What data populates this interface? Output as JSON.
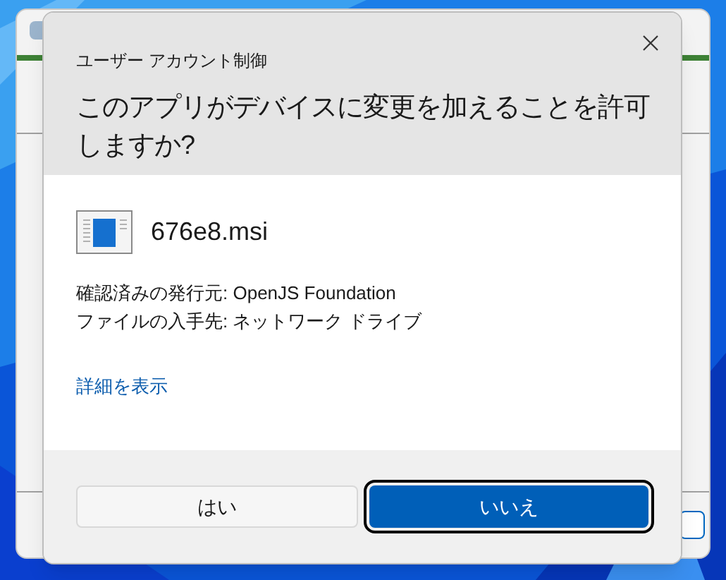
{
  "dialog": {
    "title": "ユーザー アカウント制御",
    "question": "このアプリがデバイスに変更を加えることを許可しますか?",
    "app_name": "676e8.msi",
    "details": [
      "確認済みの発行元: OpenJS Foundation",
      "ファイルの入手先: ネットワーク ドライブ"
    ],
    "more_link": "詳細を表示",
    "buttons": [
      {
        "label": "はい",
        "focused": false,
        "primary": false
      },
      {
        "label": "いいえ",
        "focused": true,
        "primary": true
      }
    ]
  }
}
